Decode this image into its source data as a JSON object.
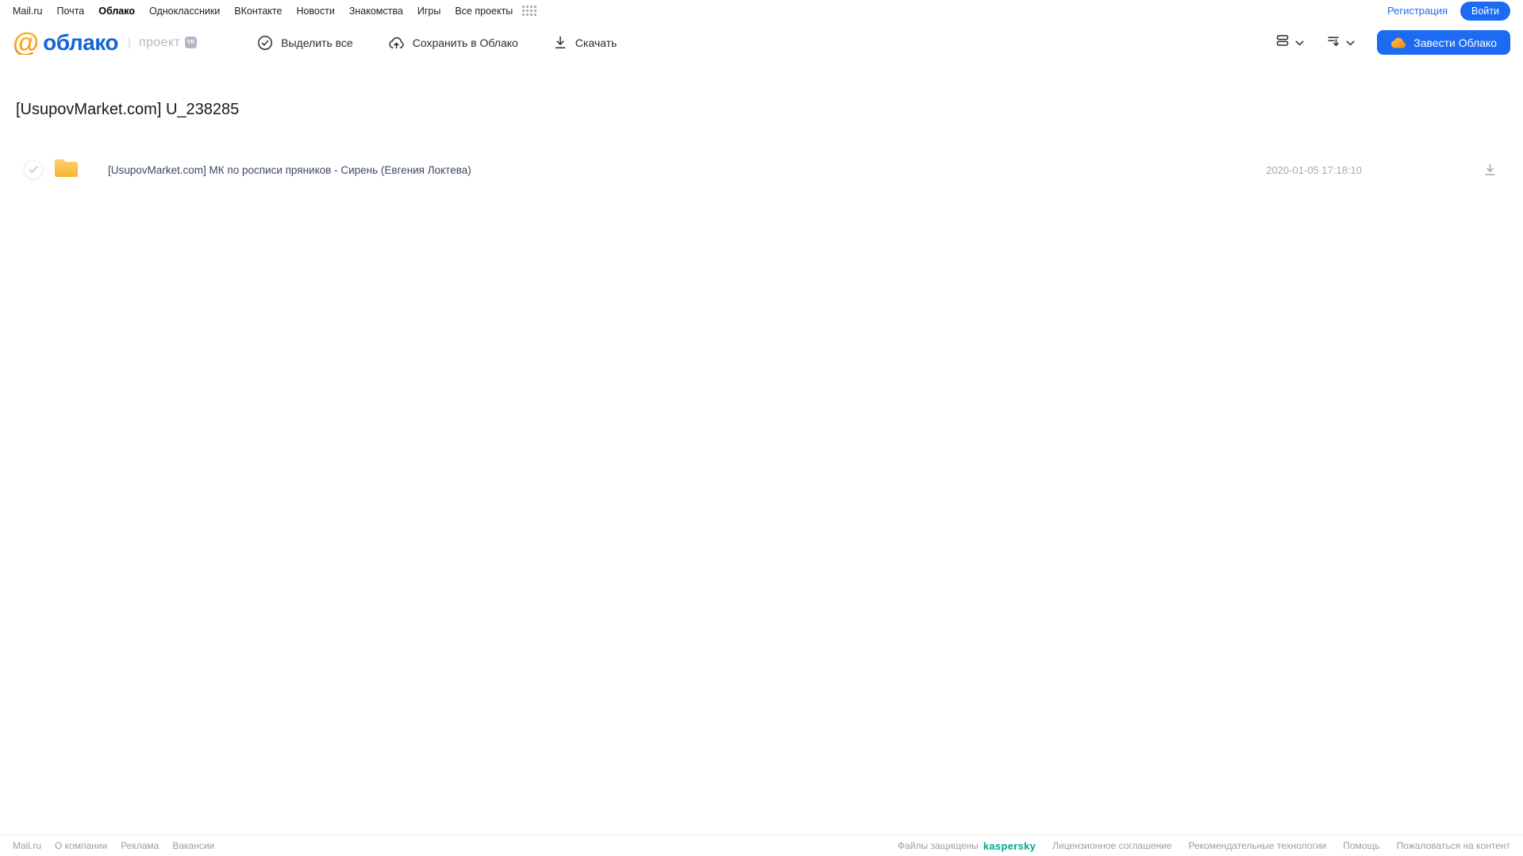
{
  "top_nav": {
    "links": [
      "Mail.ru",
      "Почта",
      "Облако",
      "Одноклассники",
      "ВКонтакте",
      "Новости",
      "Знакомства",
      "Игры",
      "Все проекты"
    ],
    "registration_label": "Регистрация",
    "login_label": "Войти"
  },
  "header": {
    "logo_at": "@",
    "logo_text": "облако",
    "project_label": "проект",
    "vk_badge": "VK",
    "toolbar": {
      "select_all": "Выделить все",
      "save_to_cloud": "Сохранить в Облако",
      "download": "Скачать"
    },
    "create_cloud_label": "Завести Облако"
  },
  "main": {
    "title": "[UsupovMarket.com] U_238285",
    "files": [
      {
        "name": "[UsupovMarket.com] МК по росписи пряников - Сирень (Евгения Локтева)",
        "date": "2020-01-05 17:18:10"
      }
    ]
  },
  "footer": {
    "links_left": [
      "Mail.ru",
      "О компании",
      "Реклама",
      "Вакансии"
    ],
    "protected_by": "Файлы защищены",
    "kaspersky_label": "kaspersky",
    "links_right": [
      "Лицензионное соглашение",
      "Рекомендательные технологии",
      "Помощь",
      "Пожаловаться на контент"
    ]
  },
  "colors": {
    "accent_blue": "#1d6bf3",
    "logo_blue": "#1565d8",
    "logo_orange": "#ff9e00",
    "folder_yellow": "#fbc54b",
    "kaspersky_green": "#00a88e"
  }
}
